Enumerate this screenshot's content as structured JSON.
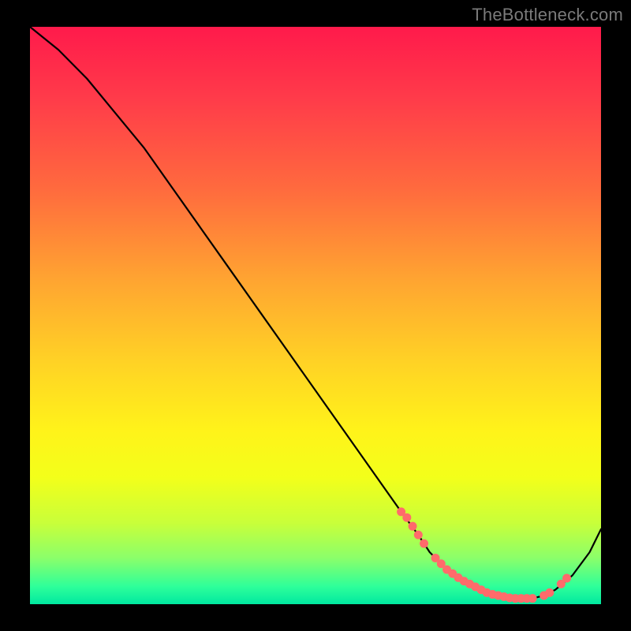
{
  "watermark": "TheBottleneck.com",
  "chart_data": {
    "type": "line",
    "title": "",
    "xlabel": "",
    "ylabel": "",
    "xlim": [
      0,
      100
    ],
    "ylim": [
      0,
      100
    ],
    "grid": false,
    "legend": false,
    "series": [
      {
        "name": "bottleneck-curve",
        "x": [
          0,
          5,
          10,
          15,
          20,
          25,
          30,
          35,
          40,
          45,
          50,
          55,
          60,
          65,
          68,
          70,
          73,
          76,
          80,
          84,
          88,
          90,
          92,
          95,
          98,
          100
        ],
        "values": [
          100,
          96,
          91,
          85,
          79,
          72,
          65,
          58,
          51,
          44,
          37,
          30,
          23,
          16,
          12,
          9,
          6,
          4,
          2,
          1,
          1,
          1.5,
          2.5,
          5,
          9,
          13
        ]
      }
    ],
    "markers": {
      "name": "highlight-dots",
      "color": "#ff6b6b",
      "x": [
        65,
        66,
        67,
        68,
        69,
        71,
        72,
        73,
        74,
        75,
        76,
        77,
        78,
        79,
        80,
        81,
        82,
        83,
        84,
        85,
        86,
        87,
        88,
        90,
        91,
        93,
        94
      ],
      "values": [
        16,
        15,
        13.5,
        12,
        10.5,
        8,
        7,
        6,
        5.3,
        4.6,
        4,
        3.5,
        3,
        2.5,
        2,
        1.7,
        1.5,
        1.3,
        1.1,
        1,
        1,
        1,
        1,
        1.5,
        2,
        3.5,
        4.5
      ]
    }
  }
}
